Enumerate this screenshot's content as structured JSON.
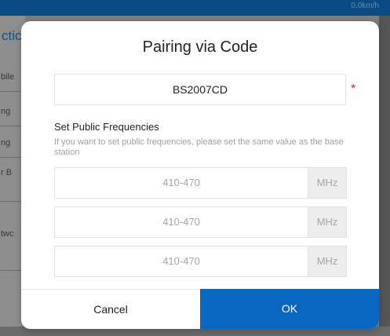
{
  "background": {
    "topbar_text": "0.0km/h",
    "left_header": "ctic",
    "left_items": [
      "bile",
      "ng",
      "ng",
      "r B",
      "twc"
    ]
  },
  "dialog": {
    "title": "Pairing via Code",
    "code_value": "BS2007CD",
    "required_mark": "*",
    "section_title": "Set Public Frequencies",
    "section_hint": "If you want to set public frequencies, please set the same value as the base station",
    "frequencies": [
      {
        "placeholder": "410-470",
        "unit": "MHz"
      },
      {
        "placeholder": "410-470",
        "unit": "MHz"
      },
      {
        "placeholder": "410-470",
        "unit": "MHz"
      }
    ],
    "cancel_label": "Cancel",
    "ok_label": "OK"
  },
  "colors": {
    "primary": "#0a66bf",
    "topbar": "#0a4b84",
    "required": "#e02020"
  }
}
